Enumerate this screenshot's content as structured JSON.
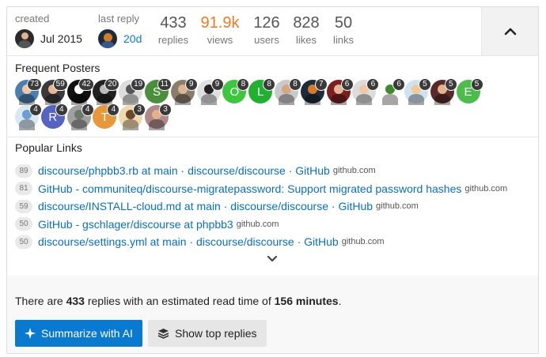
{
  "stats": {
    "created_label": "created",
    "created_value": "Jul 2015",
    "last_reply_label": "last reply",
    "last_reply_value": "20d",
    "replies": {
      "num": "433",
      "label": "replies"
    },
    "views": {
      "num": "91.9k",
      "label": "views"
    },
    "users": {
      "num": "126",
      "label": "users"
    },
    "likes": {
      "num": "828",
      "label": "likes"
    },
    "links": {
      "num": "50",
      "label": "links"
    },
    "collapse_icon": "chevron-up-icon"
  },
  "frequent_posters": {
    "title": "Frequent Posters",
    "posters": [
      {
        "count": "73",
        "bg": "#4a7fb0",
        "skin": "#f1c7a3",
        "style": "face"
      },
      {
        "count": "59",
        "bg": "#3a3a3a",
        "skin": "#e8b894",
        "style": "face"
      },
      {
        "count": "42",
        "bg": "#111111",
        "skin": "#ffffff",
        "style": "face"
      },
      {
        "count": "20",
        "bg": "#222222",
        "skin": "#bbbbbb",
        "style": "face"
      },
      {
        "count": "19",
        "bg": "#dddddd",
        "skin": "#555555",
        "style": "face"
      },
      {
        "count": "11",
        "bg": "#4a8f3c",
        "letter": "S",
        "style": "letter"
      },
      {
        "count": "9",
        "bg": "#8a7d6c",
        "skin": "#d9b592",
        "style": "face"
      },
      {
        "count": "9",
        "bg": "#e0e0e0",
        "skin": "#222222",
        "style": "face"
      },
      {
        "count": "8",
        "bg": "#3ec63e",
        "letter": "O",
        "style": "letter"
      },
      {
        "count": "8",
        "bg": "#21b02f",
        "letter": "L",
        "style": "letter"
      },
      {
        "count": "8",
        "bg": "#c9c9c9",
        "skin": "#d6a582",
        "style": "face"
      },
      {
        "count": "7",
        "bg": "#1e2b3b",
        "skin": "#d47b2a",
        "style": "face"
      },
      {
        "count": "6",
        "bg": "#7a2020",
        "skin": "#e2b696",
        "style": "face"
      },
      {
        "count": "6",
        "bg": "#dcdcdc",
        "skin": "#f0c8a8",
        "style": "face"
      },
      {
        "count": "6",
        "bg": "#ffffff",
        "skin": "#3f8a2c",
        "style": "face"
      },
      {
        "count": "5",
        "bg": "#cfe3ef",
        "skin": "#f3c99a",
        "style": "face"
      },
      {
        "count": "5",
        "bg": "#5a2a2a",
        "skin": "#e2b48e",
        "style": "face"
      },
      {
        "count": "5",
        "bg": "#4bbd4b",
        "letter": "E",
        "style": "letter"
      },
      {
        "count": "4",
        "bg": "#d8e8f5",
        "skin": "#6a9fd0",
        "style": "face"
      },
      {
        "count": "4",
        "bg": "#5563c1",
        "letter": "R",
        "style": "letter"
      },
      {
        "count": "4",
        "bg": "#a0a0a0",
        "skin": "#6b7a6b",
        "style": "face"
      },
      {
        "count": "4",
        "bg": "#e7983a",
        "letter": "T",
        "style": "letter"
      },
      {
        "count": "3",
        "bg": "#f0d8b0",
        "skin": "#6b4a2a",
        "style": "face"
      },
      {
        "count": "3",
        "bg": "#b08a8a",
        "skin": "#e3b18d",
        "style": "face"
      }
    ]
  },
  "popular_links": {
    "title": "Popular Links",
    "items": [
      {
        "clicks": "89",
        "title": "discourse/phpbb3.rb at main · discourse/discourse · GitHub",
        "domain": "github.com"
      },
      {
        "clicks": "81",
        "title": "GitHub - communiteq/discourse-migratepassword: Support migrated password hashes",
        "domain": "github.com"
      },
      {
        "clicks": "59",
        "title": "discourse/INSTALL-cloud.md at main · discourse/discourse · GitHub",
        "domain": "github.com"
      },
      {
        "clicks": "50",
        "title": "GitHub - gschlager/discourse at phpbb3",
        "domain": "github.com"
      },
      {
        "clicks": "50",
        "title": "discourse/settings.yml at main · discourse/discourse · GitHub",
        "domain": "github.com"
      }
    ]
  },
  "summary": {
    "prefix": "There are ",
    "replies": "433",
    "middle": " replies with an estimated read time of ",
    "minutes": "156 minutes",
    "suffix": ".",
    "summarize_label": "Summarize with AI",
    "top_replies_label": "Show top replies"
  },
  "colors": {
    "accent": "#0a7ad1",
    "views_hot": "#f07b21"
  }
}
